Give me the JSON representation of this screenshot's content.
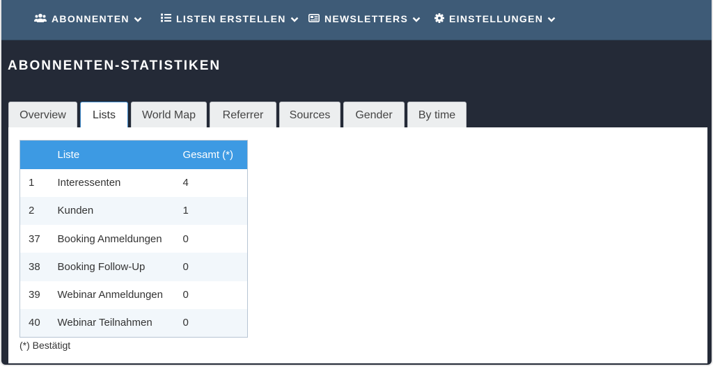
{
  "nav": {
    "items": [
      {
        "label": "ABONNENTEN",
        "icon": "users-icon"
      },
      {
        "label": "LISTEN ERSTELLEN",
        "icon": "list-icon"
      },
      {
        "label": "NEWSLETTERS",
        "icon": "newspaper-icon"
      },
      {
        "label": "EINSTELLUNGEN",
        "icon": "gear-icon"
      }
    ]
  },
  "page": {
    "title": "ABONNENTEN-STATISTIKEN"
  },
  "tabs": [
    {
      "label": "Overview"
    },
    {
      "label": "Lists",
      "active": true
    },
    {
      "label": "World Map"
    },
    {
      "label": "Referrer"
    },
    {
      "label": "Sources"
    },
    {
      "label": "Gender"
    },
    {
      "label": "By time"
    }
  ],
  "table": {
    "headers": [
      "",
      "Liste",
      "Gesamt (*)"
    ],
    "rows": [
      [
        "1",
        "Interessenten",
        "4"
      ],
      [
        "2",
        "Kunden",
        "1"
      ],
      [
        "37",
        "Booking Anmeldungen",
        "0"
      ],
      [
        "38",
        "Booking Follow-Up",
        "0"
      ],
      [
        "39",
        "Webinar Anmeldungen",
        "0"
      ],
      [
        "40",
        "Webinar Teilnahmen",
        "0"
      ]
    ]
  },
  "footnote": "(*) Bestätigt",
  "colors": {
    "navbar": "#3e5b77",
    "background": "#242a37",
    "table_header": "#3d9ae3",
    "active_tab_border": "#3a86c8"
  }
}
